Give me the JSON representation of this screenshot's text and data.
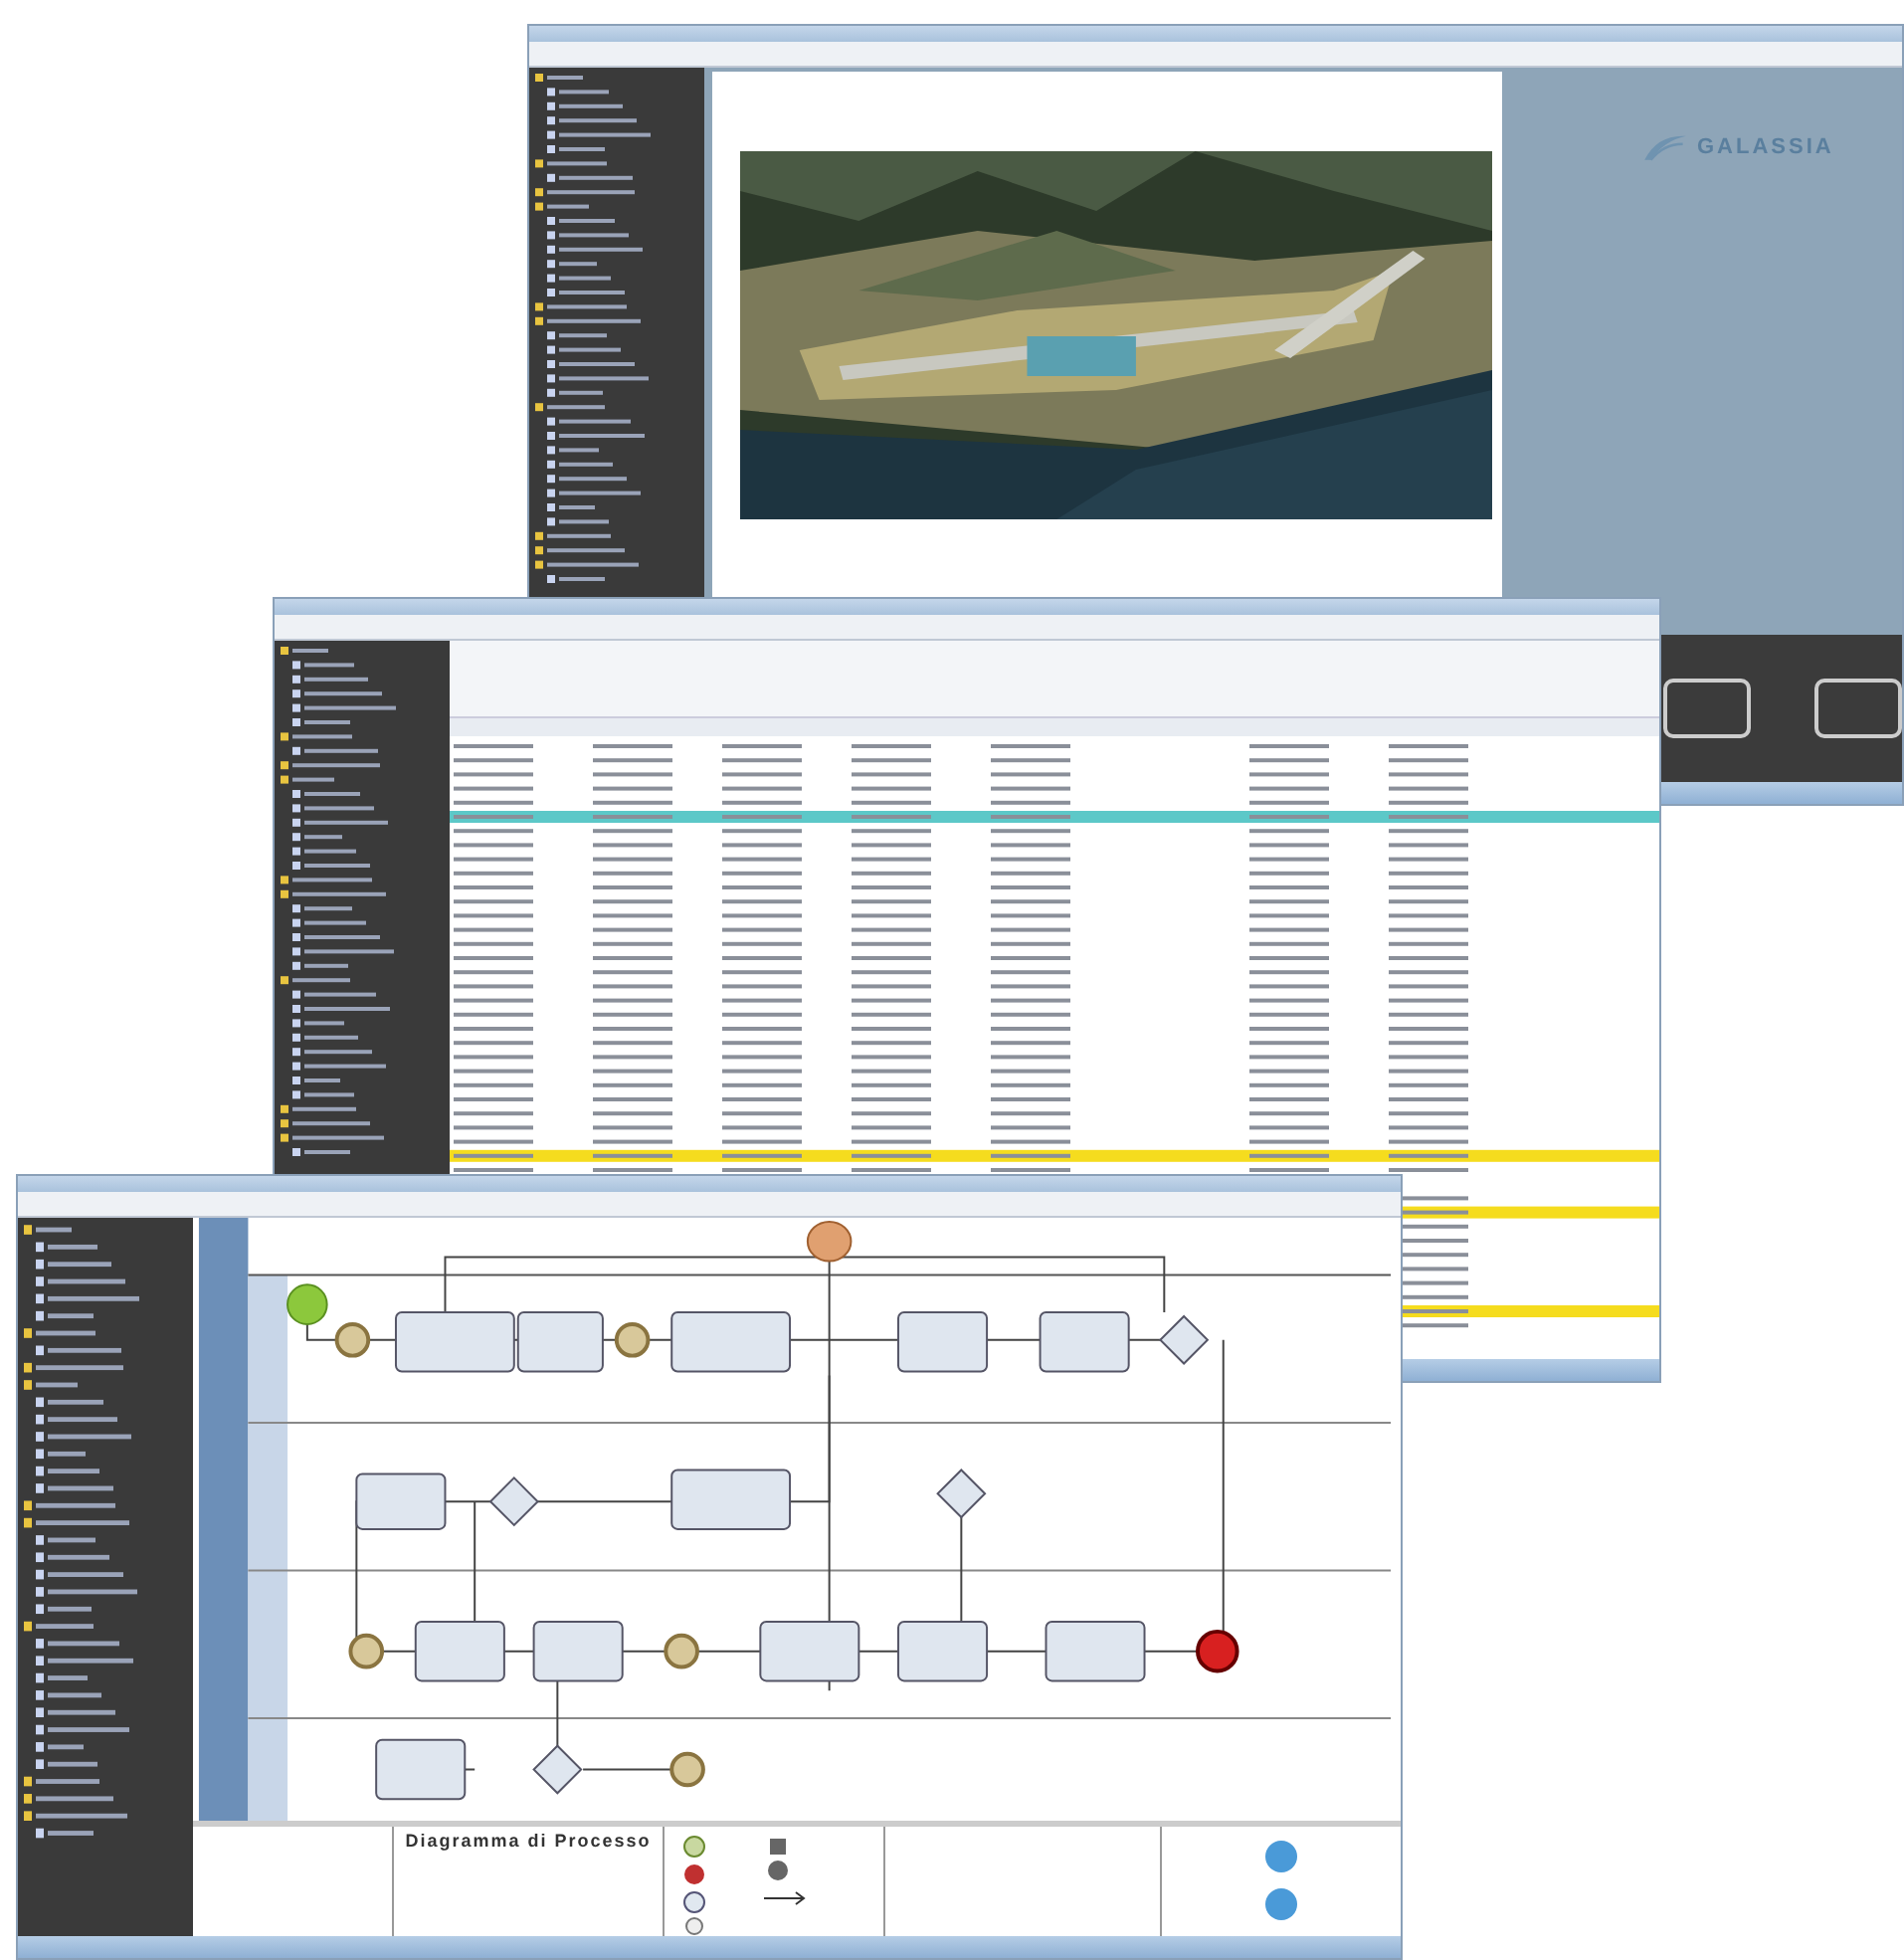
{
  "windows": [
    {
      "kind": "map",
      "logo": "GALASSIA"
    },
    {
      "kind": "table"
    },
    {
      "kind": "diagram",
      "title": "Diagramma di Processo"
    }
  ]
}
